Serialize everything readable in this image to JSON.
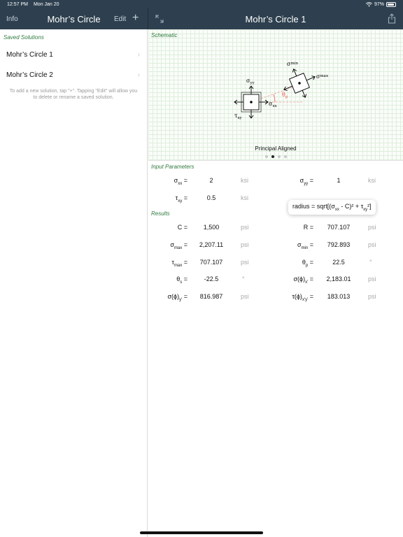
{
  "status": {
    "time": "12:57 PM",
    "date": "Mon Jan 20",
    "battery": "97%"
  },
  "left_nav": {
    "info": "Info",
    "title": "Mohr’s Circle",
    "edit": "Edit",
    "add": "+"
  },
  "right_nav": {
    "title": "Mohr’s Circle 1"
  },
  "sidebar": {
    "header": "Saved Solutions",
    "items": [
      {
        "label": "Mohr’s Circle 1"
      },
      {
        "label": "Mohr’s Circle 2"
      }
    ],
    "help": "To add a new solution, tap \"+\". Tapping \"Edit\" will allow you to delete or rename a saved solution."
  },
  "schematic": {
    "header": "Schematic",
    "caption": "Principal Aligned",
    "page_count": 4,
    "active_page": 1,
    "labels": {
      "syy": "σ",
      "syy_sub": "yy",
      "sxx": "σ",
      "sxx_sub": "xx",
      "txy": "τ",
      "txy_sub": "xy",
      "smin": "σ",
      "smin_sub": "min",
      "smax": "σ",
      "smax_sub": "max",
      "tp": "θ",
      "tp_sub": "p"
    }
  },
  "inputs": {
    "header": "Input Parameters",
    "sxx": {
      "sym": "σ",
      "sub": "xx",
      "eq": " =",
      "value": "2",
      "unit": "ksi"
    },
    "syy": {
      "sym": "σ",
      "sub": "yy",
      "eq": " =",
      "value": "1",
      "unit": "ksi"
    },
    "txy": {
      "sym": "τ",
      "sub": "xy",
      "eq": " =",
      "value": "0.5",
      "unit": "ksi"
    }
  },
  "tooltip": {
    "pre": "radius = sqrt[(σ",
    "sub1": "xx",
    "mid": " - C)² + τ",
    "sub2": "xy",
    "post": "²]"
  },
  "results": {
    "header": "Results",
    "C": {
      "sym": "C",
      "sub": "",
      "eq": " =",
      "value": "1,500",
      "unit": "psi"
    },
    "R": {
      "sym": "R",
      "sub": "",
      "eq": " =",
      "value": "707.107",
      "unit": "psi"
    },
    "smax": {
      "sym": "σ",
      "sub": "max",
      "eq": " =",
      "value": "2,207.11",
      "unit": "psi"
    },
    "smin": {
      "sym": "σ",
      "sub": "min",
      "eq": " =",
      "value": "792.893",
      "unit": "psi"
    },
    "tmax": {
      "sym": "τ",
      "sub": "max",
      "eq": " =",
      "value": "707.107",
      "unit": "psi"
    },
    "thp": {
      "sym": "θ",
      "sub": "p",
      "eq": " =",
      "value": "22.5",
      "unit": "°"
    },
    "ths": {
      "sym": "θ",
      "sub": "s",
      "eq": " =",
      "value": "-22.5",
      "unit": "°"
    },
    "sphix": {
      "sym": "σ(ϕ)",
      "sub": "x'",
      "eq": " =",
      "value": "2,183.01",
      "unit": "psi"
    },
    "sphiy": {
      "sym": "σ(ϕ)",
      "sub": "y'",
      "eq": " =",
      "value": "816.987",
      "unit": "psi"
    },
    "tphi": {
      "sym": "τ(ϕ)",
      "sub": "x'y'",
      "eq": " =",
      "value": "183.013",
      "unit": "psi"
    }
  }
}
